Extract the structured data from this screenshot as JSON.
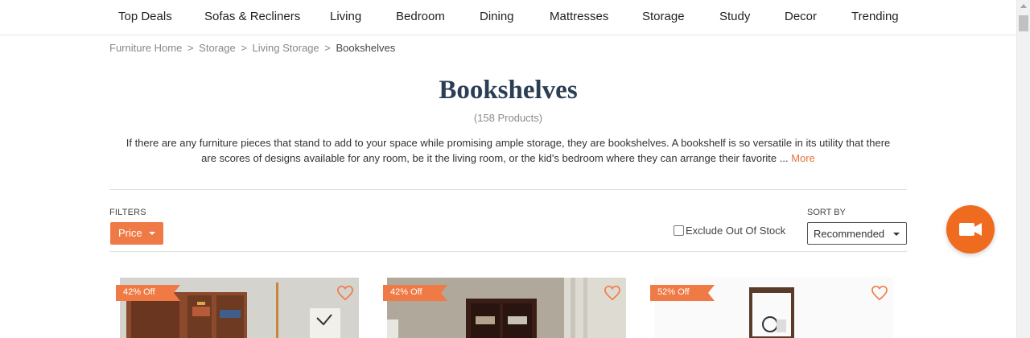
{
  "nav": {
    "items": [
      "Top Deals",
      "Sofas & Recliners",
      "Living",
      "Bedroom",
      "Dining",
      "Mattresses",
      "Storage",
      "Study",
      "Decor",
      "Trending"
    ]
  },
  "breadcrumb": {
    "items": [
      "Furniture Home",
      "Storage",
      "Living Storage"
    ],
    "separator": ">",
    "current": "Bookshelves"
  },
  "page": {
    "title": "Bookshelves",
    "count": "(158 Products)",
    "description_line1": "If there are any furniture pieces that stand to add to your space while promising ample storage, they are bookshelves. A bookshelf is so versatile in its utility that there",
    "description_line2": "are scores of designs available for any room, be it the living room, or the kid's bedroom where they can arrange their favorite ...",
    "more_label": "More"
  },
  "filters": {
    "label": "FILTERS",
    "price_label": "Price",
    "exclude_label": "Exclude Out Of Stock",
    "exclude_checked": false
  },
  "sort": {
    "label": "SORT BY",
    "selected": "Recommended"
  },
  "products": [
    {
      "badge": "42% Off",
      "icon": "heart-outline-icon"
    },
    {
      "badge": "42% Off",
      "icon": "heart-outline-icon"
    },
    {
      "badge": "52% Off",
      "icon": "heart-outline-icon"
    }
  ],
  "colors": {
    "accent": "#ef7a45",
    "title": "#2c3e56",
    "video_button": "#ef6b1f",
    "more_link": "#e8703a"
  },
  "icons": {
    "video_button": "video-camera-icon"
  }
}
